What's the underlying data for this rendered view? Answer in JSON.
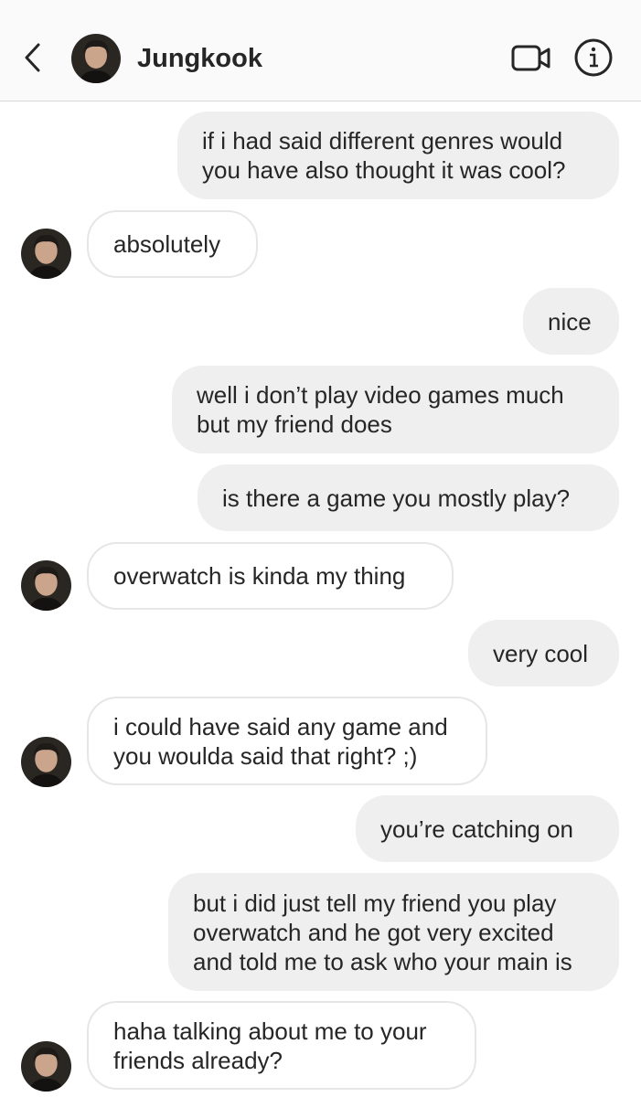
{
  "header": {
    "contact_name": "Jungkook",
    "back_icon": "chevron-left-icon",
    "video_icon": "video-camera-icon",
    "info_icon": "info-circle-icon"
  },
  "messages": [
    {
      "direction": "sent",
      "text": "if i had said different genres would\nyou have also thought it was cool?"
    },
    {
      "direction": "received",
      "text": "absolutely"
    },
    {
      "direction": "sent",
      "text": "nice"
    },
    {
      "direction": "sent",
      "text": "well i don’t play video games much\nbut my friend does"
    },
    {
      "direction": "sent",
      "text": "is there a game you mostly play?"
    },
    {
      "direction": "received",
      "text": "overwatch is kinda my thing"
    },
    {
      "direction": "sent",
      "text": "very cool"
    },
    {
      "direction": "received",
      "text": "i could have said any game and\nyou woulda said that right? ;)"
    },
    {
      "direction": "sent",
      "text": "you’re catching on"
    },
    {
      "direction": "sent",
      "text": "but i did just tell my friend you play\noverwatch and he got very excited\nand told me to ask who your main is"
    },
    {
      "direction": "received",
      "text": "haha talking about me to your\nfriends already?"
    }
  ],
  "colors": {
    "sent_bubble": "#efefef",
    "received_bubble_border": "#e6e6e6",
    "header_background": "#fafafa",
    "text": "#262626"
  }
}
